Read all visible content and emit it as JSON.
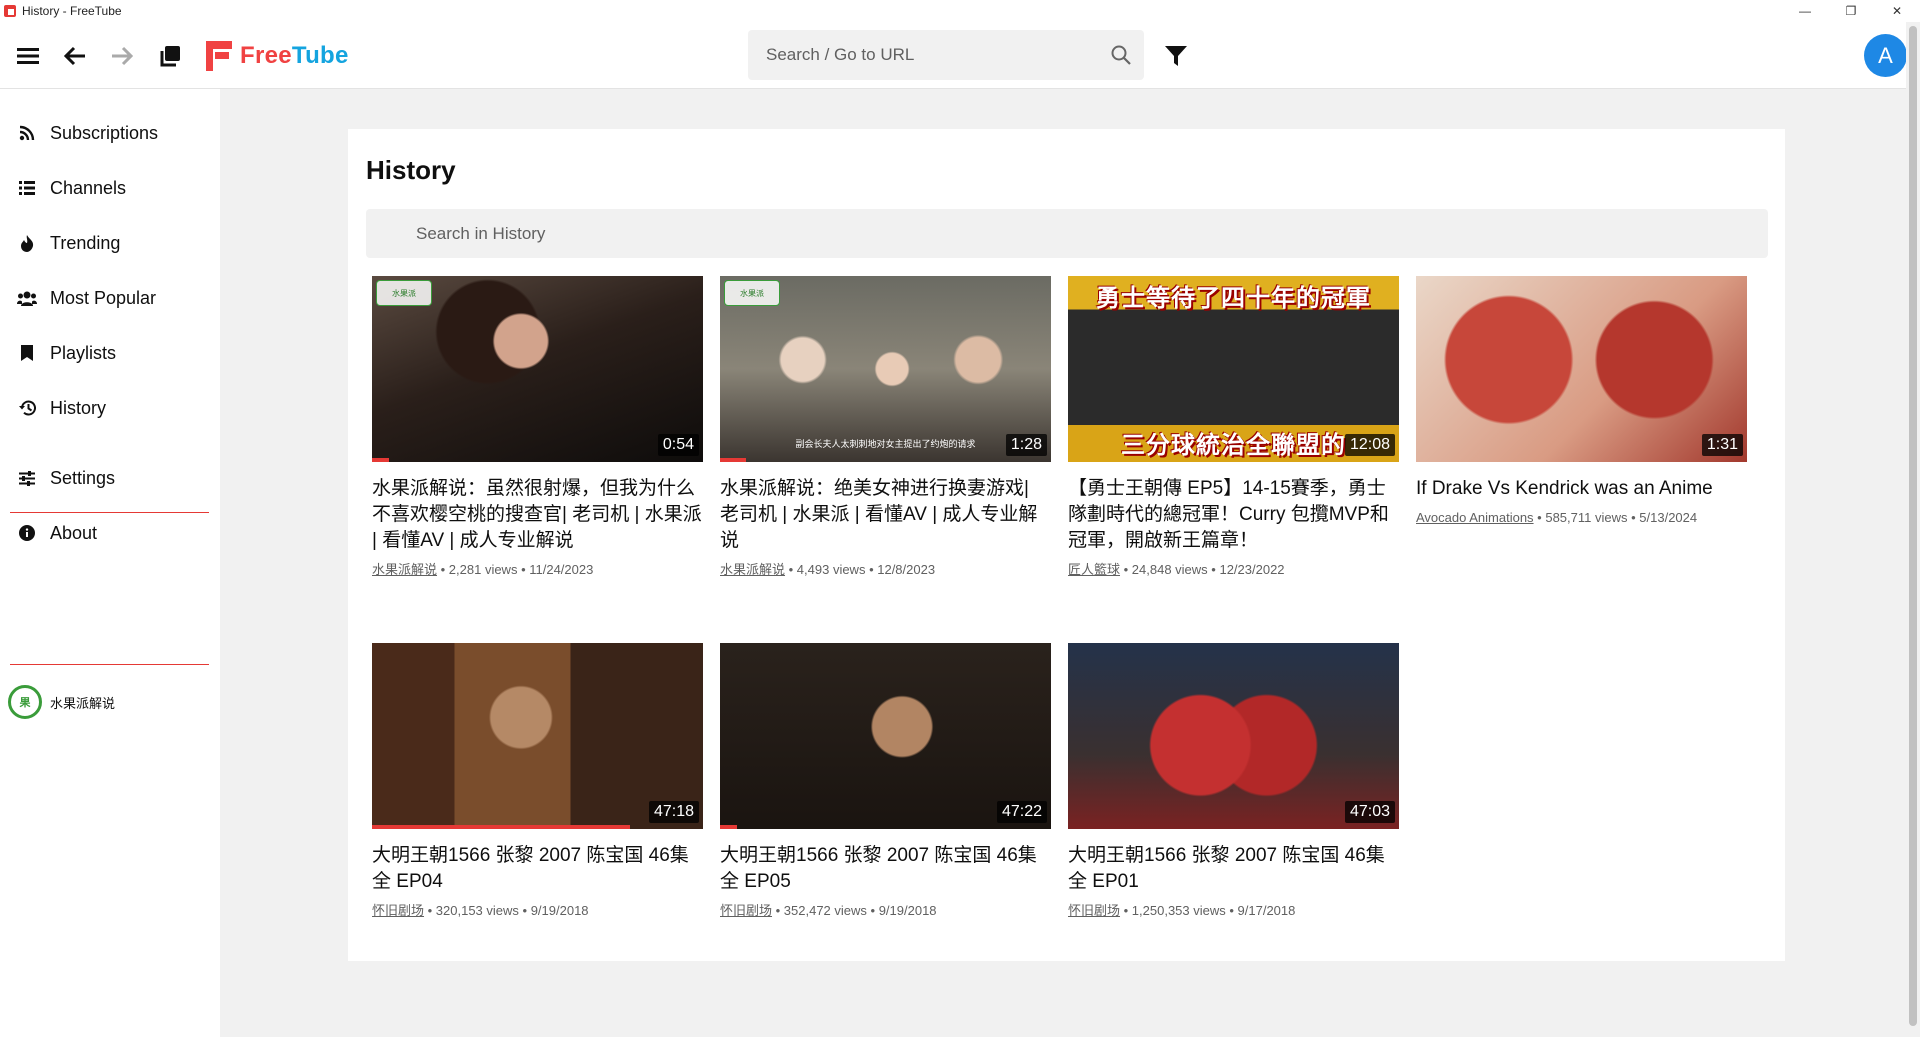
{
  "window": {
    "title": "History - FreeTube",
    "minimize": "—",
    "maximize": "❐",
    "close": "✕"
  },
  "topnav": {
    "logo_free": "Free",
    "logo_tube": "Tube",
    "search_placeholder": "Search / Go to URL",
    "avatar_letter": "A"
  },
  "sidebar": {
    "items": [
      {
        "label": "Subscriptions",
        "icon": "rss-icon"
      },
      {
        "label": "Channels",
        "icon": "list-icon"
      },
      {
        "label": "Trending",
        "icon": "fire-icon"
      },
      {
        "label": "Most Popular",
        "icon": "users-icon"
      },
      {
        "label": "Playlists",
        "icon": "bookmark-icon"
      },
      {
        "label": "History",
        "icon": "history-icon"
      },
      {
        "label": "Settings",
        "icon": "sliders-icon"
      },
      {
        "label": "About",
        "icon": "info-icon"
      }
    ],
    "channel": {
      "name": "水果派解说",
      "avatar_text": "果"
    }
  },
  "main": {
    "title": "History",
    "search_placeholder": "Search in History",
    "videos": [
      {
        "title": "水果派解说：虽然很射爆，但我为什么不喜欢樱空桃的搜查官| 老司机 | 水果派 | 看懂AV | 成人专业解说",
        "channel": "水果派解说",
        "views": "2,281 views",
        "date": "11/24/2023",
        "duration": "0:54",
        "progress": 0.05,
        "watermark": "水果派"
      },
      {
        "title": "水果派解说：绝美女神进行换妻游戏| 老司机 | 水果派 | 看懂AV | 成人专业解说",
        "channel": "水果派解说",
        "views": "4,493 views",
        "date": "12/8/2023",
        "duration": "1:28",
        "progress": 0.08,
        "watermark": "水果派",
        "subtitle": "副会长夫人太刺刺地对女主提出了约炮的请求"
      },
      {
        "title": "【勇士王朝傳 EP5】14-15賽季，勇士隊劃時代的總冠軍！Curry 包攬MVP和冠軍，開啟新王篇章！",
        "channel": "匠人籃球",
        "views": "24,848 views",
        "date": "12/23/2022",
        "duration": "12:08",
        "progress": 0.0,
        "caption_top": "勇士等待了四十年的冠軍",
        "caption_bottom": "三分球統治全聯盟的"
      },
      {
        "title": "If Drake Vs Kendrick was an Anime",
        "channel": "Avocado Animations",
        "views": "585,711 views",
        "date": "5/13/2024",
        "duration": "1:31",
        "progress": 0.0
      },
      {
        "title": "大明王朝1566 张黎 2007 陈宝国 46集全 EP04",
        "channel": "怀旧剧场",
        "views": "320,153 views",
        "date": "9/19/2018",
        "duration": "47:18",
        "progress": 0.78
      },
      {
        "title": "大明王朝1566 张黎 2007 陈宝国 46集全 EP05",
        "channel": "怀旧剧场",
        "views": "352,472 views",
        "date": "9/19/2018",
        "duration": "47:22",
        "progress": 0.05
      },
      {
        "title": "大明王朝1566 张黎 2007 陈宝国 46集全 EP01",
        "channel": "怀旧剧场",
        "views": "1,250,353 views",
        "date": "9/17/2018",
        "duration": "47:03",
        "progress": 0.0
      }
    ]
  }
}
